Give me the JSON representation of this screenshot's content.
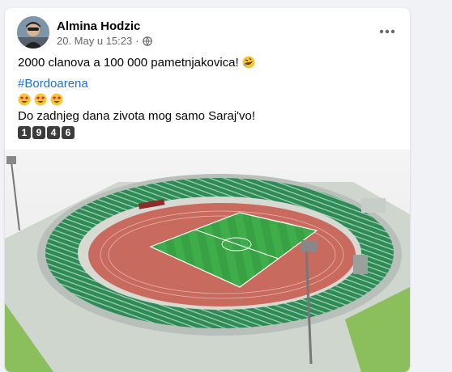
{
  "post": {
    "author": "Almina Hodzic",
    "date": "20. May u 15:23",
    "privacy_icon": "globe-icon",
    "more_icon": "more-horizontal-icon",
    "line1": "2000 clanova a 100 000 pametnjakovica!",
    "line1_emoji": "rolling-on-floor-laughing-emoji",
    "hashtag": "#Bordoarena",
    "emoji_row": [
      "heart-eyes-emoji",
      "heart-eyes-emoji",
      "heart-eyes-emoji"
    ],
    "line3": "Do zadnjeg dana zivota mog samo Saraj'vo!",
    "keycaps": [
      "1",
      "9",
      "4",
      "6"
    ],
    "image_alt": "stadium-render-image"
  },
  "colors": {
    "link": "#216fdb",
    "text": "#050505",
    "secondary": "#65676b",
    "seats": "#2e8b57",
    "track": "#c96a5e",
    "pitch": "#3aa845"
  }
}
